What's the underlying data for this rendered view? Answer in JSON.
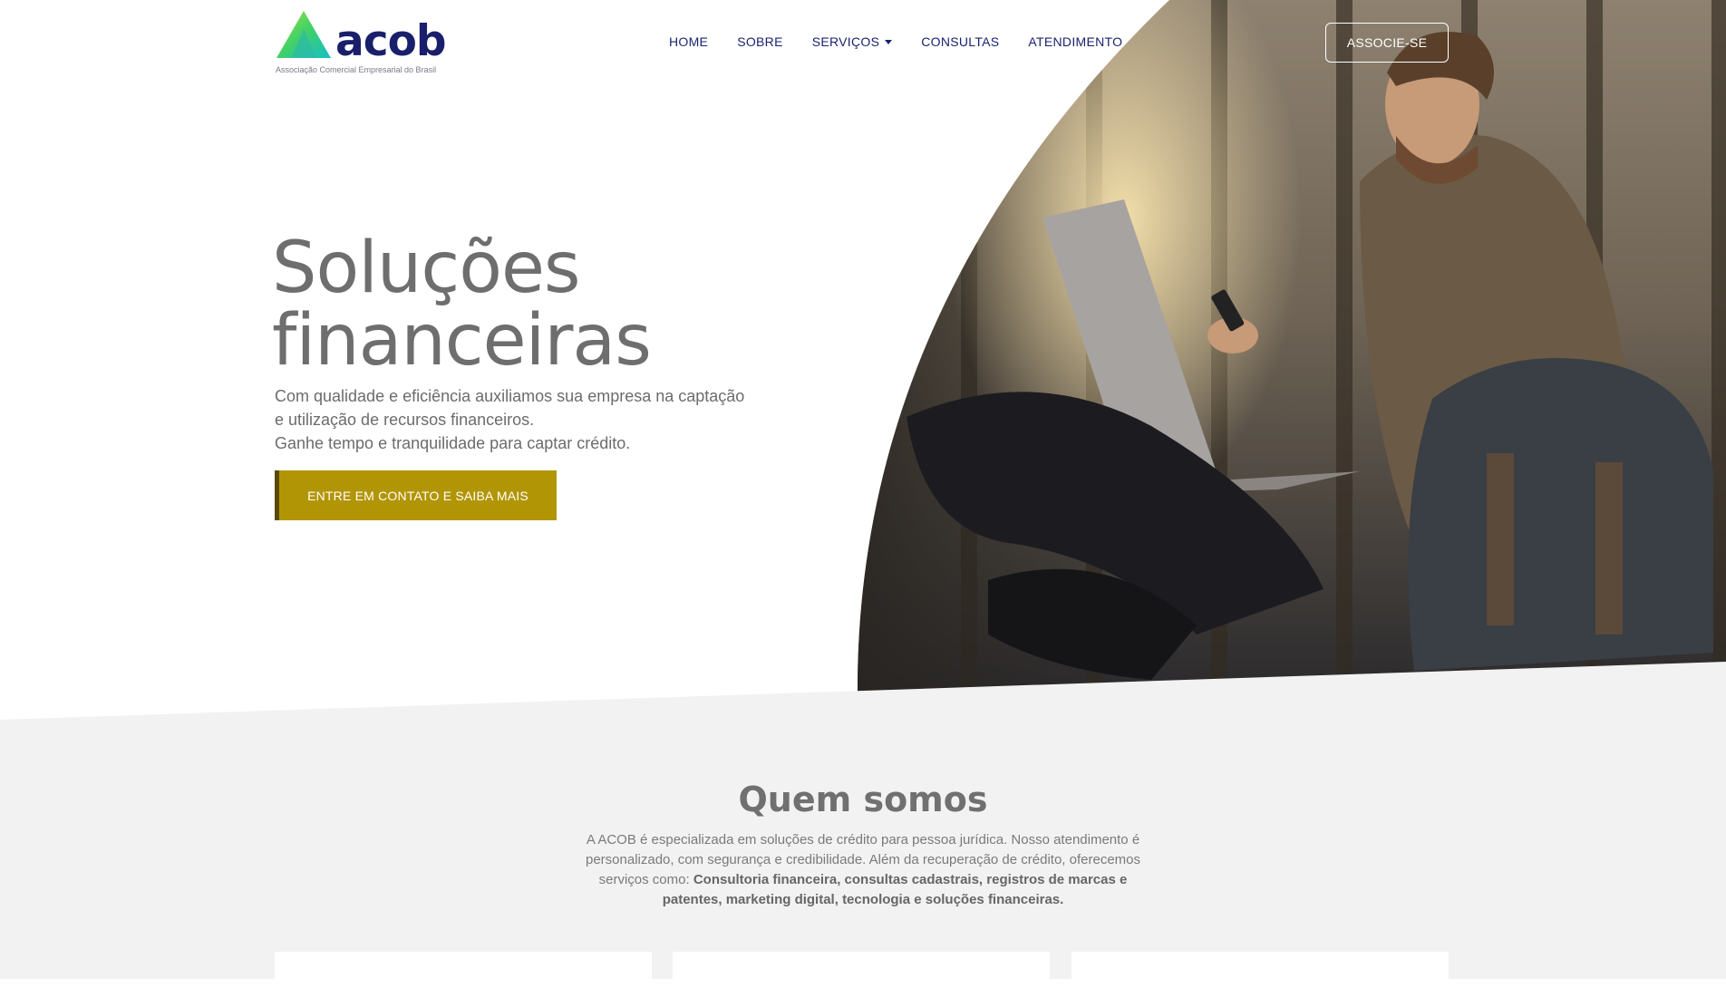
{
  "header": {
    "logo_text": "acob",
    "logo_subtitle": "Associação Comercial Empresarial do Brasil",
    "nav": [
      {
        "label": "HOME"
      },
      {
        "label": "SOBRE"
      },
      {
        "label": "SERVIÇOS"
      },
      {
        "label": "CONSULTAS"
      },
      {
        "label": "ATENDIMENTO"
      }
    ],
    "cta_label": "ASSOCIE-SE"
  },
  "hero": {
    "title_line1": "Soluções",
    "title_line2": "financeiras",
    "desc_line1": "Com qualidade e eficiência auxiliamos sua empresa na captação",
    "desc_line2": "e utilização de recursos financeiros.",
    "desc_line3": "Ganhe tempo e tranquilidade para captar crédito.",
    "button_label": "ENTRE EM CONTATO E SAIBA MAIS"
  },
  "about": {
    "title": "Quem somos",
    "text_plain": "A ACOB é especializada em soluções de crédito para pessoa jurídica. Nosso atendimento é personalizado, com segurança e credibilidade. Além da recuperação de crédito, oferecemos serviços como:",
    "text_bold": "Consultoria financeira, consultas cadastrais, registros de marcas e patentes, marketing digital, tecnologia e soluções financeiras."
  },
  "colors": {
    "accent_gold": "#b29504",
    "nav_blue": "#1a2370",
    "logo_green": "#4bd35b"
  }
}
